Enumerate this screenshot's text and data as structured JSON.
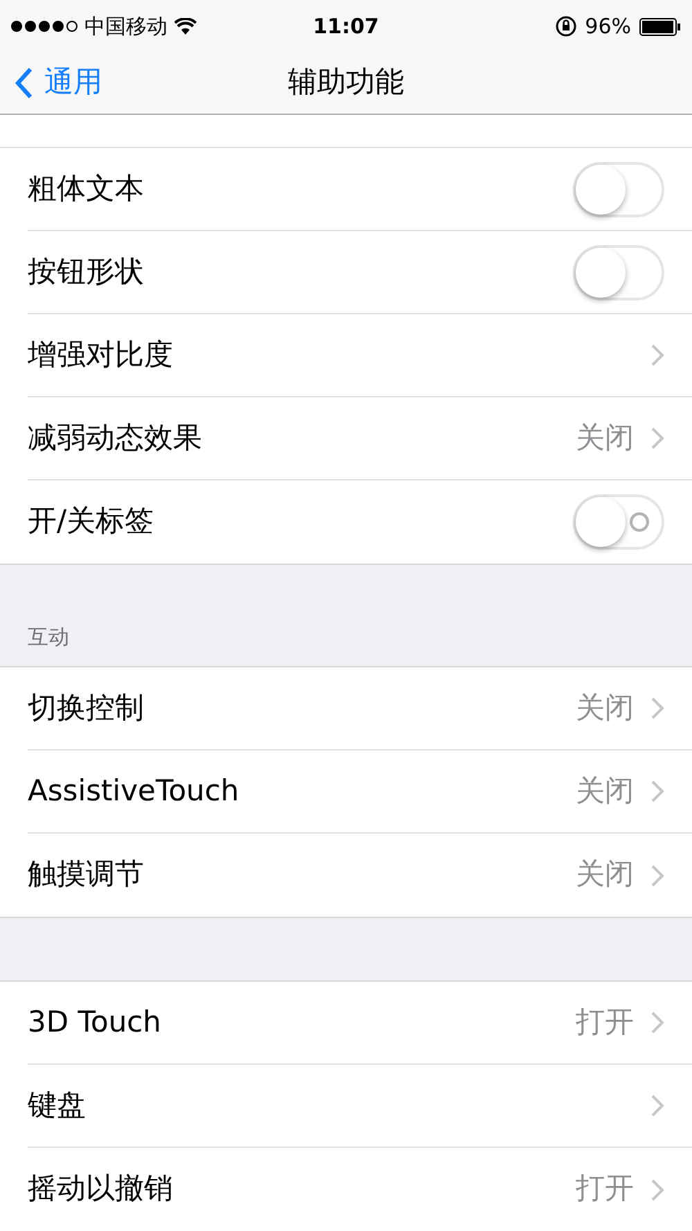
{
  "status_bar": {
    "carrier": "中国移动",
    "time": "11:07",
    "battery": "96%"
  },
  "nav": {
    "back": "通用",
    "title": "辅助功能"
  },
  "sections": [
    {
      "rows": [
        {
          "kind": "toggle",
          "label": "粗体文本",
          "on": false
        },
        {
          "kind": "toggle",
          "label": "按钮形状",
          "on": false
        },
        {
          "kind": "link",
          "label": "增强对比度"
        },
        {
          "kind": "link",
          "label": "减弱动态效果",
          "value": "关闭"
        },
        {
          "kind": "toggle",
          "label": "开/关标签",
          "on": false,
          "show_label": true
        }
      ]
    },
    {
      "header": "互动",
      "rows": [
        {
          "kind": "link",
          "label": "切换控制",
          "value": "关闭"
        },
        {
          "kind": "link",
          "label": "AssistiveTouch",
          "value": "关闭"
        },
        {
          "kind": "link",
          "label": "触摸调节",
          "value": "关闭"
        }
      ]
    },
    {
      "rows": [
        {
          "kind": "link",
          "label": "3D Touch",
          "value": "打开"
        },
        {
          "kind": "link",
          "label": "键盘"
        },
        {
          "kind": "link",
          "label": "摇动以撤销",
          "value": "打开"
        }
      ]
    }
  ]
}
